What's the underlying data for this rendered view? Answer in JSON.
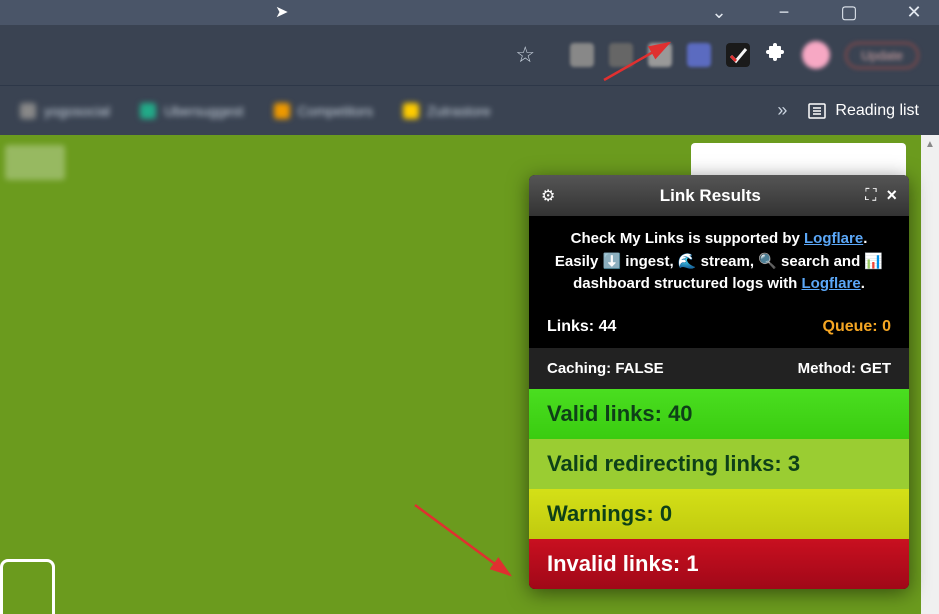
{
  "titlebar": {
    "chevron": "⌄",
    "min": "−",
    "max": "▢",
    "close": "✕"
  },
  "toolbar": {
    "star": "☆",
    "puzzle": "✦"
  },
  "bookmarks": {
    "items": [
      {
        "label": "yogosocial"
      },
      {
        "label": "Ubersuggest"
      },
      {
        "label": "Competitors"
      },
      {
        "label": "Zutrastore"
      }
    ],
    "chevrons": "»",
    "readingList": "Reading list"
  },
  "panel": {
    "title": "Link Results",
    "desc": {
      "line1_pre": "Check My Links is supported by ",
      "logflare1": "Logflare",
      "line1_post": ".",
      "line2": "Easily ⬇️ ingest, 🌊 stream, 🔍 search and 📊 dashboard structured logs with ",
      "logflare2": "Logflare",
      "line2_post": "."
    },
    "linksLabel": "Links:",
    "linksCount": "44",
    "queueLabel": "Queue:",
    "queueCount": "0",
    "cachingLabel": "Caching:",
    "cachingVal": "FALSE",
    "methodLabel": "Method:",
    "methodVal": "GET",
    "results": {
      "valid": {
        "label": "Valid links:",
        "count": "40"
      },
      "redirect": {
        "label": "Valid redirecting links:",
        "count": "3"
      },
      "warning": {
        "label": "Warnings:",
        "count": "0"
      },
      "invalid": {
        "label": "Invalid links:",
        "count": "1"
      }
    }
  }
}
